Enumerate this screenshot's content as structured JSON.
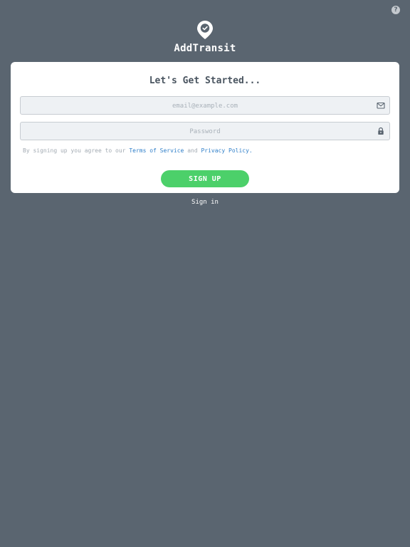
{
  "header": {
    "app_name": "AddTransit",
    "logo_icon": "map-pin-check-icon",
    "help_icon": "question-circle-icon",
    "help_glyph": "?"
  },
  "form": {
    "title": "Let's Get Started...",
    "email": {
      "value": "",
      "placeholder": "email@example.com",
      "icon": "envelope-icon"
    },
    "password": {
      "value": "",
      "placeholder": "Password",
      "icon": "lock-icon"
    },
    "terms": {
      "prefix": "By signing up you agree to our ",
      "terms_link": "Terms of Service",
      "middle": " and ",
      "privacy_link": "Privacy Policy",
      "suffix": "."
    },
    "submit_label": "SIGN UP"
  },
  "footer": {
    "signin_label": "Sign in"
  },
  "colors": {
    "background": "#5a6570",
    "primary_button": "#4cd06a",
    "link": "#2f7fc9",
    "card": "#ffffff"
  }
}
